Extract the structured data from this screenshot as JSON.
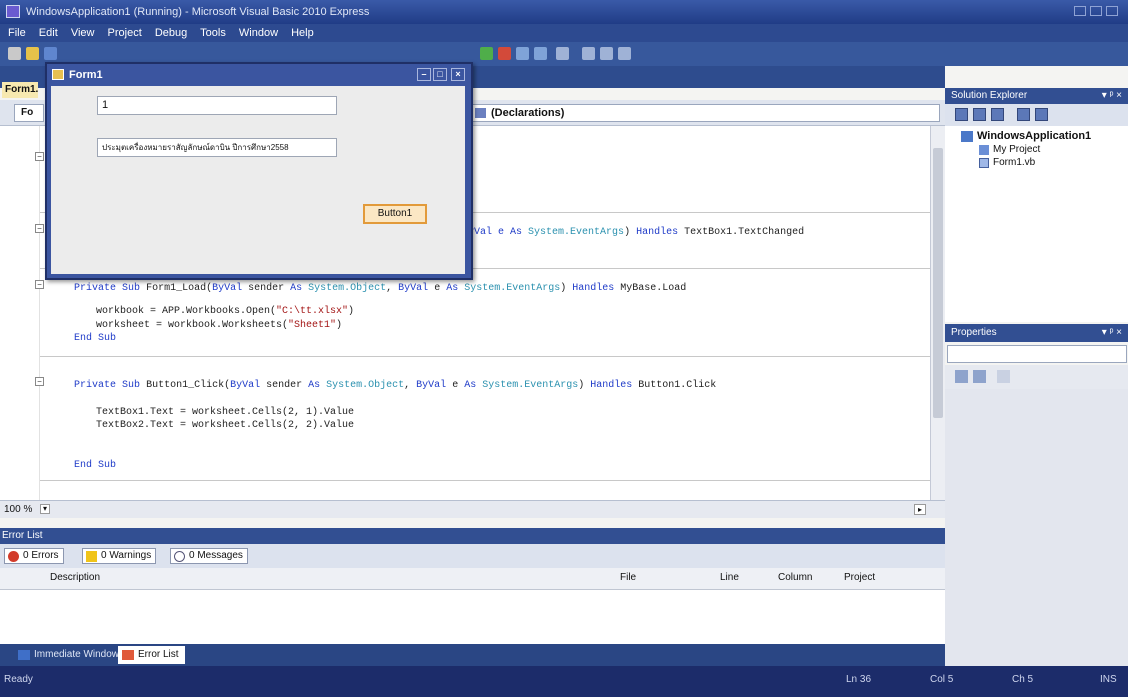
{
  "window": {
    "title": "WindowsApplication1 (Running) - Microsoft Visual Basic 2010 Express"
  },
  "menu": [
    "File",
    "Edit",
    "View",
    "Project",
    "Debug",
    "Tools",
    "Window",
    "Help"
  ],
  "doc_tab": {
    "label": "Form1."
  },
  "editor": {
    "class_combo": "Fo",
    "method_combo": "(Declarations)",
    "line_textchanged": {
      "pre": "yVal e ",
      "as": "As",
      "type": "System.EventArgs",
      "handles": "Handles",
      "target": "TextBox1.TextChanged"
    },
    "line_load_sub": {
      "kw1": "Private",
      "kw2": "Sub",
      "name": "Form1_Load(",
      "byval": "ByVal",
      "mid": " sender ",
      "as": "As",
      "type1": "System.Object",
      "sep": ", ",
      "byval2": "ByVal",
      "e": " e ",
      "as2": "As",
      "type2": "System.EventArgs",
      "handles": "Handles",
      "target": "MyBase.Load"
    },
    "line_wb_open": {
      "pre": "workbook = APP.Workbooks.Open(",
      "str": "\"C:\\tt.xlsx\"",
      "post": ")"
    },
    "line_ws_set": {
      "pre": "worksheet = workbook.Worksheets(",
      "str": "\"Sheet1\"",
      "post": ")"
    },
    "end_sub_1": "End Sub",
    "line_click_sub": {
      "kw1": "Private",
      "kw2": "Sub",
      "name": "Button1_Click(",
      "byval": "ByVal",
      "mid": " sender ",
      "as": "As",
      "type1": "System.Object",
      "sep": ", ",
      "byval2": "ByVal",
      "e": " e ",
      "as2": "As",
      "type2": "System.EventArgs",
      "handles": "Handles",
      "target": "Button1.Click"
    },
    "line_tb1": "TextBox1.Text = worksheet.Cells(2, 1).Value",
    "line_tb2": "TextBox2.Text = worksheet.Cells(2, 2).Value",
    "end_sub_2": "End Sub",
    "zoom": "100 %"
  },
  "error_list": {
    "title": "Error List",
    "errors": "0 Errors",
    "warnings": "0 Warnings",
    "messages": "0 Messages",
    "columns": [
      "Description",
      "File",
      "Line",
      "Column",
      "Project"
    ]
  },
  "bottom_tabs": [
    "Immediate Window",
    "Error List"
  ],
  "solution_explorer": {
    "title": "Solution Explorer",
    "pin": "▾ ᵖ ×",
    "items": [
      "WindowsApplication1",
      "My Project",
      "Form1.vb"
    ]
  },
  "properties": {
    "title": "Properties",
    "pin": "▾ ᵖ ×"
  },
  "status": {
    "ready": "Ready",
    "ln": "Ln 36",
    "col": "Col 5",
    "ch": "Ch 5",
    "mode": "INS"
  },
  "form1": {
    "title": "Form1",
    "textbox1": "1",
    "textbox2": "ประมุตเครื่องหมายราสัญลักษณ์ดาบิน ปีการศึกษา2558",
    "button1": "Button1"
  }
}
